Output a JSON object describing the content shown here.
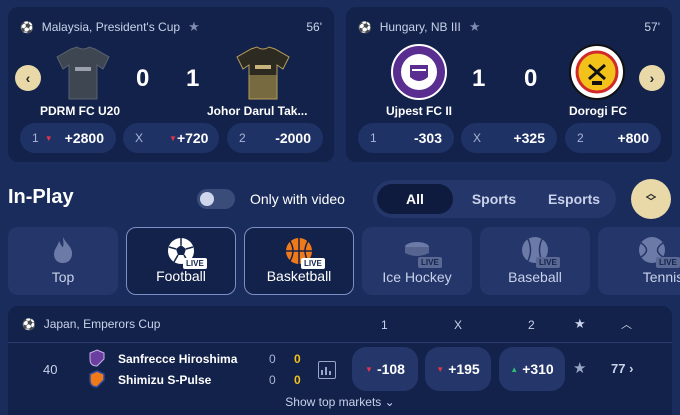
{
  "featured": [
    {
      "league": "Malaysia, President's Cup",
      "minute": "56'",
      "home": "PDRM FC U20",
      "away": "Johor Darul Tak...",
      "score_home": "0",
      "score_away": "1",
      "odds": [
        {
          "label": "1",
          "value": "+2800",
          "trend": "down"
        },
        {
          "label": "X",
          "value": "+720",
          "trend": "down"
        },
        {
          "label": "2",
          "value": "-2000",
          "trend": ""
        }
      ]
    },
    {
      "league": "Hungary, NB III",
      "minute": "57'",
      "home": "Ujpest FC II",
      "away": "Dorogi FC",
      "score_home": "1",
      "score_away": "0",
      "odds": [
        {
          "label": "1",
          "value": "-303",
          "trend": ""
        },
        {
          "label": "X",
          "value": "+325",
          "trend": ""
        },
        {
          "label": "2",
          "value": "+800",
          "trend": ""
        }
      ]
    }
  ],
  "inplay": {
    "title": "In-Play",
    "toggle_label": "Only with video",
    "segments": [
      "All",
      "Sports",
      "Esports"
    ],
    "active_segment": "All"
  },
  "sports": [
    {
      "label": "Top",
      "icon": "flame-icon",
      "live": false
    },
    {
      "label": "Football",
      "icon": "football-icon",
      "live": true,
      "selected": true
    },
    {
      "label": "Basketball",
      "icon": "basketball-icon",
      "live": true,
      "selected": true
    },
    {
      "label": "Ice Hockey",
      "icon": "puck-icon",
      "live": true
    },
    {
      "label": "Baseball",
      "icon": "baseball-icon",
      "live": true
    },
    {
      "label": "Tennis",
      "icon": "tennis-icon",
      "live": true
    }
  ],
  "live_badge": "LIVE",
  "league_section": {
    "league": "Japan, Emperors Cup",
    "col1": "1",
    "colX": "X",
    "col2": "2",
    "match": {
      "minute": "40",
      "home": "Sanfrecce Hiroshima",
      "away": "Shimizu S-Pulse",
      "home_goals": "0",
      "away_goals": "0",
      "home_corners": "0",
      "away_corners": "0",
      "odds": [
        {
          "value": "-108",
          "trend": "down"
        },
        {
          "value": "+195",
          "trend": "down"
        },
        {
          "value": "+310",
          "trend": "up"
        }
      ],
      "markets_count": "77"
    },
    "show_more": "Show top markets"
  },
  "colors": {
    "accent_gold": "#e9d9a8",
    "down": "#e0354b",
    "up": "#2fbf71",
    "orange": "#f07a1a"
  }
}
